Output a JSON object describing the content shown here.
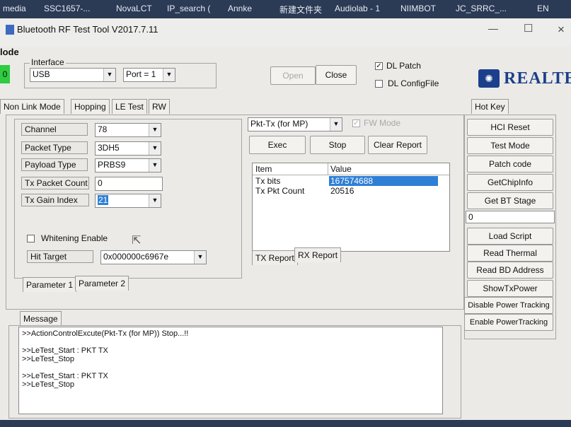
{
  "taskbar": {
    "items": [
      "media",
      "SSC1657-...",
      "NovaLCT",
      "IP_search (",
      "Annke",
      "新建文件夹",
      "Audiolab - 1",
      "NIIMBOT",
      "JC_SRRC_...",
      "EN"
    ]
  },
  "window": {
    "title": "Bluetooth RF Test Tool V2017.7.11",
    "mode_label": "lode",
    "controls": {
      "minimize": "—",
      "maximize": "☐",
      "close": "×"
    }
  },
  "interface": {
    "group_label": "Interface",
    "led_label": "0",
    "type_value": "USB",
    "port_value": "Port = 1",
    "open_label": "Open",
    "close_label": "Close",
    "dl_patch_label": "DL Patch",
    "dl_patch_checked": true,
    "dl_config_label": "DL ConfigFile",
    "dl_config_checked": false
  },
  "brand": {
    "logo_text": "REALTEK"
  },
  "tabs": [
    "Non Link Mode",
    "Hopping",
    "LE Test",
    "RW"
  ],
  "params": {
    "channel_label": "Channel",
    "channel_value": "78",
    "packet_type_label": "Packet Type",
    "packet_type_value": "3DH5",
    "payload_type_label": "Payload Type",
    "payload_type_value": "PRBS9",
    "tx_packet_count_label": "Tx Packet Count",
    "tx_packet_count_value": "0",
    "tx_gain_index_label": "Tx Gain Index",
    "tx_gain_index_value": "21",
    "whitening_label": "Whitening Enable",
    "hit_target_label": "Hit Target",
    "hit_target_value": "0x000000c6967e",
    "sub_tabs": [
      "Parameter 1",
      "Parameter 2"
    ]
  },
  "report": {
    "mode_value": "Pkt-Tx (for MP)",
    "fw_mode_label": "FW Mode",
    "exec_label": "Exec",
    "stop_label": "Stop",
    "clear_label": "Clear Report",
    "columns": [
      "Item",
      "Value"
    ],
    "rows": [
      [
        "Tx bits",
        "167574688"
      ],
      [
        "Tx Pkt Count",
        "20516"
      ]
    ],
    "tabs": [
      "TX Report",
      "RX Report"
    ]
  },
  "hotkey": {
    "tab_label": "Hot Key",
    "buttons_top": [
      "HCI Reset",
      "Test Mode",
      "Patch code",
      "GetChipInfo",
      "Get BT Stage"
    ],
    "stage_value": "0",
    "buttons_bottom": [
      "Load Script",
      "Read Thermal",
      "Read BD Address",
      "ShowTxPower",
      "Disable Power Tracking",
      "Enable PowerTracking"
    ]
  },
  "message": {
    "tab_label": "Message",
    "lines": [
      ">>ActionControlExcute(Pkt-Tx (for MP)) Stop...!!",
      "",
      ">>LeTest_Start : PKT TX",
      ">>LeTest_Stop",
      "",
      ">>LeTest_Start : PKT TX",
      ">>LeTest_Stop"
    ]
  },
  "colors": {
    "selection": "#2f7fd6",
    "led": "#2ecc40",
    "realtek_blue": "#1b3f8b"
  }
}
